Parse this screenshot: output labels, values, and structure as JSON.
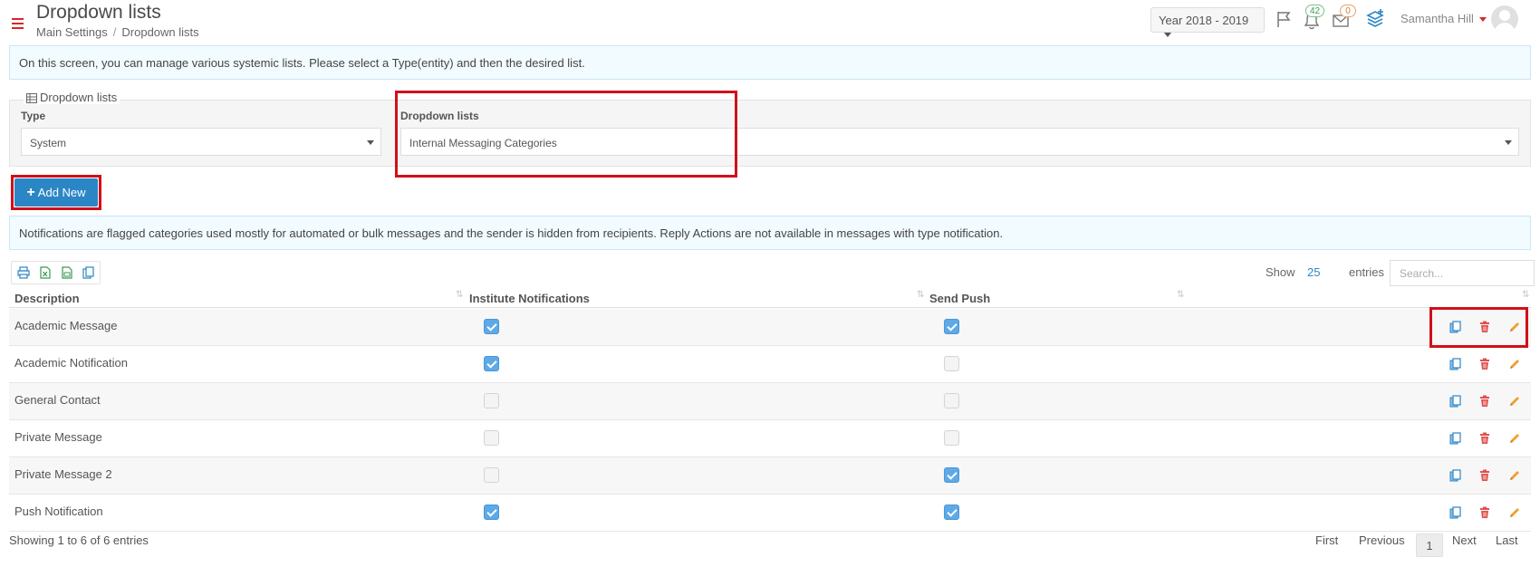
{
  "header": {
    "title": "Dropdown lists",
    "breadcrumb": [
      "Main Settings",
      "/",
      "Dropdown lists"
    ],
    "year": "Year 2018 - 2019",
    "notifications_count": "42",
    "messages_count": "0",
    "user_name": "Samantha Hill"
  },
  "info_top": "On this screen, you can manage various systemic lists. Please select a Type(entity) and then the desired list.",
  "filters": {
    "legend": "Dropdown lists",
    "type_label": "Type",
    "type_value": "System",
    "list_label": "Dropdown lists",
    "list_value": "Internal Messaging Categories"
  },
  "add_button": "Add New",
  "info_notice": "Notifications are flagged categories used mostly for automated or bulk messages and the sender is hidden from recipients. Reply Actions are not available in messages with type notification.",
  "table_controls": {
    "show_label": "Show",
    "show_value": "25",
    "entries_label": "entries",
    "search_placeholder": "Search..."
  },
  "columns": [
    "Description",
    "Institute Notifications",
    "Send Push"
  ],
  "rows": [
    {
      "description": "Academic Message",
      "institute_notifications": true,
      "send_push": true
    },
    {
      "description": "Academic Notification",
      "institute_notifications": true,
      "send_push": false
    },
    {
      "description": "General Contact",
      "institute_notifications": false,
      "send_push": false
    },
    {
      "description": "Private Message",
      "institute_notifications": false,
      "send_push": false
    },
    {
      "description": "Private Message 2",
      "institute_notifications": false,
      "send_push": true
    },
    {
      "description": "Push Notification",
      "institute_notifications": true,
      "send_push": true
    }
  ],
  "footer": {
    "info": "Showing 1 to 6 of 6 entries",
    "first": "First",
    "previous": "Previous",
    "current": "1",
    "next": "Next",
    "last": "Last"
  },
  "colors": {
    "accent": "#2b86c5",
    "highlight": "#d0101a",
    "delete": "#e0504f",
    "edit": "#f0a030"
  }
}
